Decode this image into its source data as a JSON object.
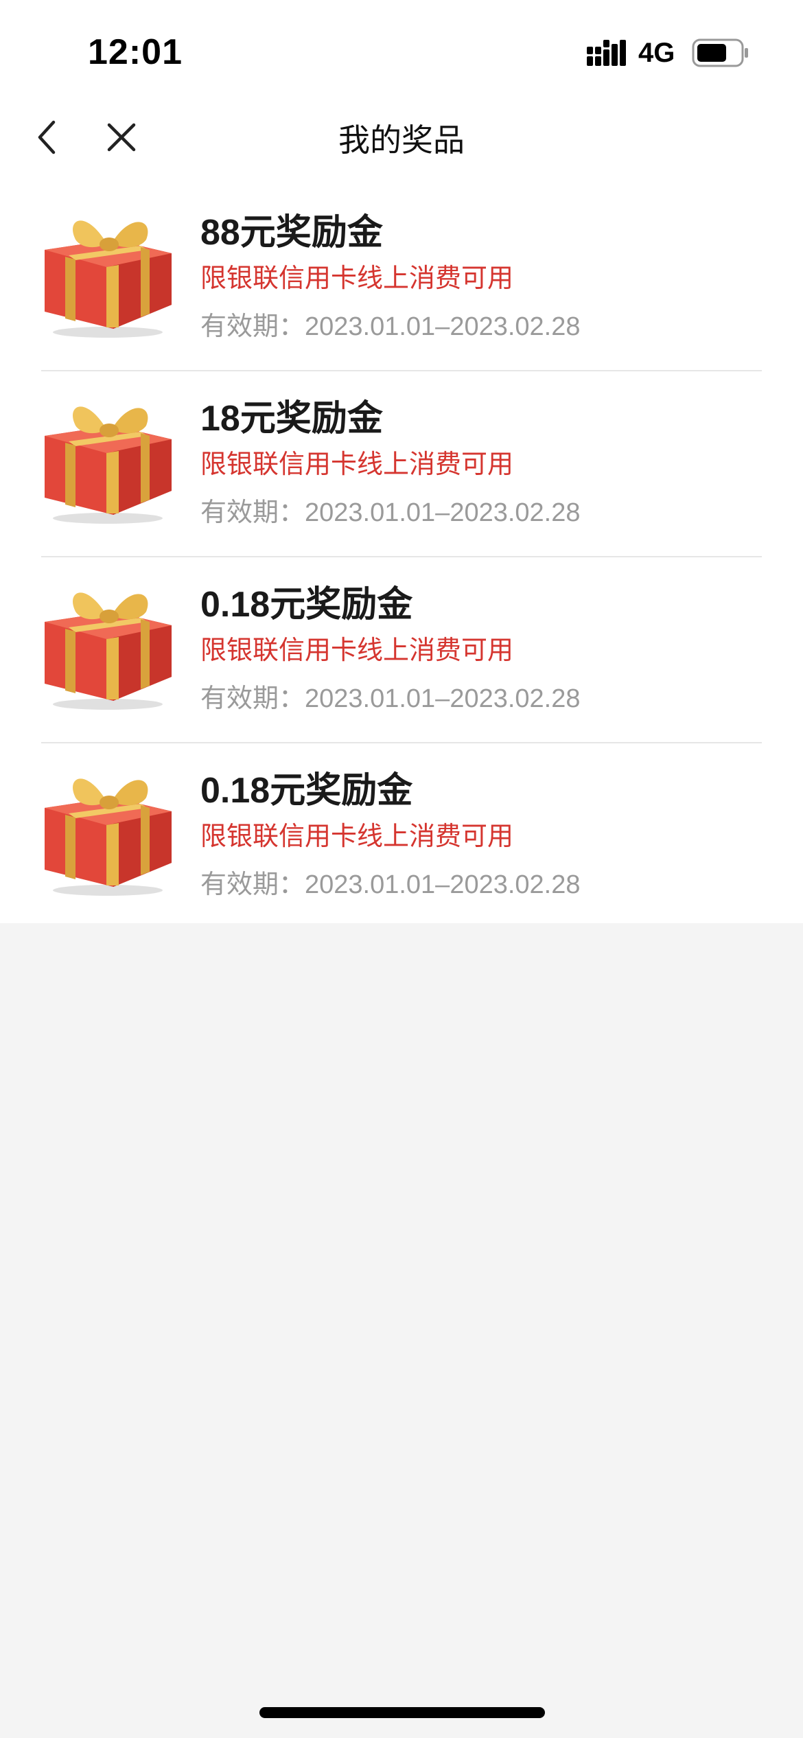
{
  "status_bar": {
    "time": "12:01",
    "network": "4G",
    "battery_level": 0.7
  },
  "nav": {
    "title": "我的奖品"
  },
  "prizes": [
    {
      "name": "88元奖励金",
      "restriction": "限银联信用卡线上消费可用",
      "validity": "有效期：2023.01.01–2023.02.28",
      "icon": "gift-box-icon"
    },
    {
      "name": "18元奖励金",
      "restriction": "限银联信用卡线上消费可用",
      "validity": "有效期：2023.01.01–2023.02.28",
      "icon": "gift-box-icon"
    },
    {
      "name": "0.18元奖励金",
      "restriction": "限银联信用卡线上消费可用",
      "validity": "有效期：2023.01.01–2023.02.28",
      "icon": "gift-box-icon"
    },
    {
      "name": "0.18元奖励金",
      "restriction": "限银联信用卡线上消费可用",
      "validity": "有效期：2023.01.01–2023.02.28",
      "icon": "gift-box-icon"
    }
  ],
  "colors": {
    "restriction_red": "#d5352f",
    "page_background": "#f4f4f4"
  }
}
